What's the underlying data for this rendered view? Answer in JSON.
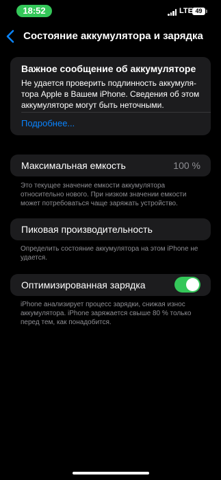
{
  "status_bar": {
    "time": "18:52",
    "network": "LTE",
    "battery_level": "49",
    "time_pill_color": "#34c759",
    "icons": [
      "signal-icon",
      "battery-icon"
    ]
  },
  "nav": {
    "back_icon": "chevron-left-icon",
    "title": "Состояние аккумулятора и зарядка",
    "accent_color": "#0a84ff"
  },
  "important_message": {
    "title": "Важное сообщение об аккумуляторе",
    "body": "Не удается проверить подлинность аккумуля-тора Apple в Вашем iPhone. Сведения об этом аккумуляторе могут быть неточными.",
    "link": "Подробнее..."
  },
  "max_capacity": {
    "label": "Максимальная емкость",
    "value": "100 %",
    "footnote": "Это текущее значение емкости аккумулятора относительно нового. При низком значении емкости может потребоваться чаще заряжать устройство."
  },
  "peak_performance": {
    "label": "Пиковая производительность",
    "footnote": "Определить состояние аккумулятора на этом iPhone не удается."
  },
  "optimized_charging": {
    "label": "Оптимизированная зарядка",
    "enabled": true,
    "toggle_color": "#34c759",
    "footnote": "iPhone анализирует процесс зарядки, снижая износ аккумулятора. iPhone заряжается свыше 80 % только перед тем, как понадобится."
  }
}
